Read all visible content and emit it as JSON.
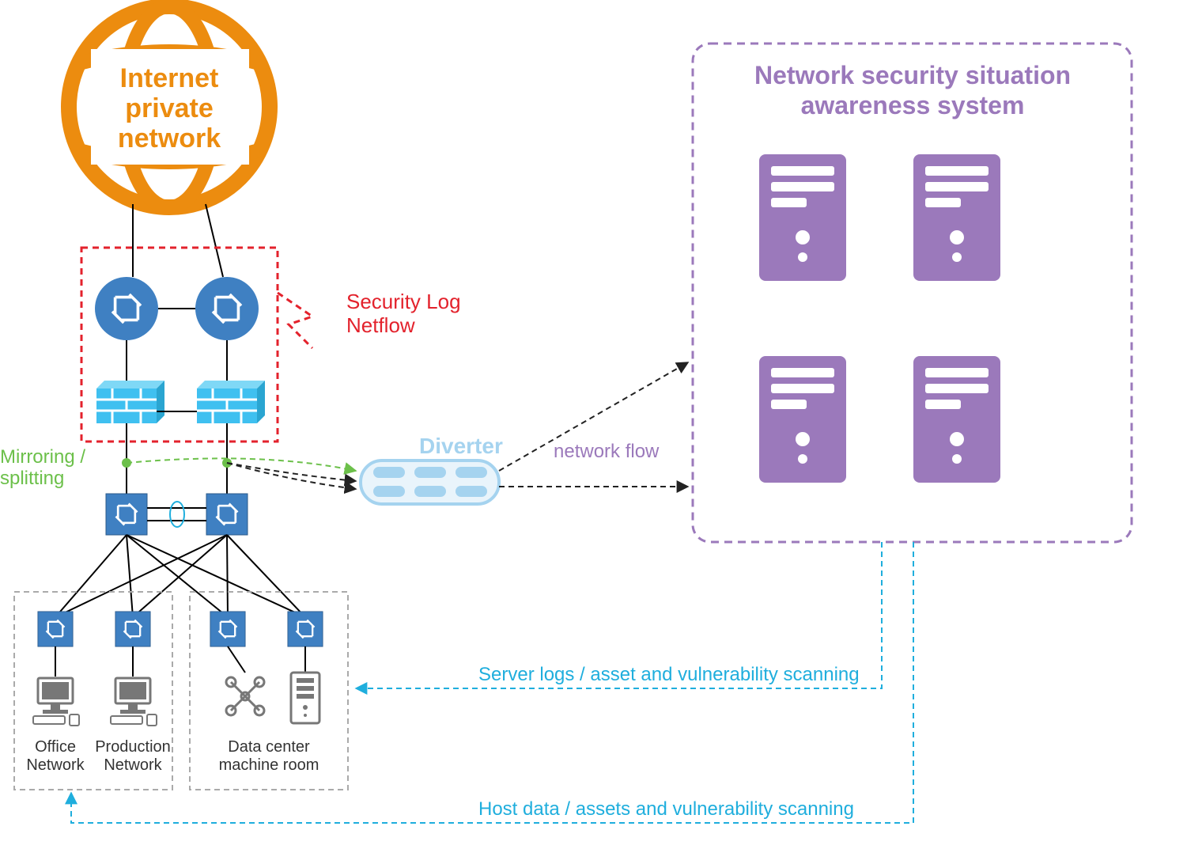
{
  "internet_label_line1": "Internet",
  "internet_label_line2": "private",
  "internet_label_line3": "network",
  "security_log_line1": "Security Log",
  "security_log_line2": "Netflow",
  "mirroring_line1": "Mirroring /",
  "mirroring_line2": "splitting",
  "diverter_label": "Diverter",
  "network_flow_label": "network flow",
  "awareness_title_line1": "Network security situation",
  "awareness_title_line2": "awareness system",
  "office_network_line1": "Office",
  "office_network_line2": "Network",
  "production_network_line1": "Production",
  "production_network_line2": "Network",
  "data_center_line1": "Data center",
  "data_center_line2": "machine room",
  "server_logs_label": "Server logs / asset and vulnerability scanning",
  "host_data_label": "Host data / assets and vulnerability scanning",
  "colors": {
    "orange": "#EC8C0F",
    "red": "#E3222C",
    "blue_router": "#3F80C2",
    "light_blue": "#A5D3EF",
    "cyan_firewall": "#3FC0F0",
    "purple": "#9B79BB",
    "green": "#6CC04A",
    "cyan_text": "#1FAEDD",
    "gray": "#888888"
  }
}
